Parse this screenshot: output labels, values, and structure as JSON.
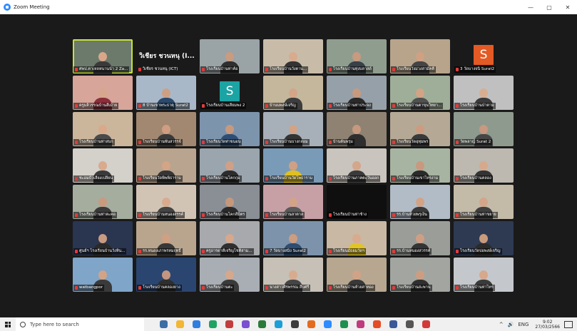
{
  "window": {
    "title": "Zoom Meeting",
    "controls": [
      "—",
      "▢",
      "✕"
    ]
  },
  "participants": [
    {
      "name": "ศพป.ตาเหลหนานน้า 2 Za...",
      "bg": "#6b7a6b",
      "skin": "#d9a68a",
      "shirt": "#3a3a3a",
      "active": true
    },
    {
      "name": "วิเชียร ชวนหนุ (ICT)",
      "bg": "#1a1a1a",
      "type": "nameonly",
      "big": "วิเชียร ชวนหนุ (I..."
    },
    {
      "name": "โรงเรียนบ้านท่าค้อ",
      "bg": "#9aa3a6",
      "skin": "#c99b7f",
      "shirt": "#2e2e2e"
    },
    {
      "name": "โรงเรียนบ้านวังตาน...",
      "bg": "#c8bca8",
      "skin": "#d8ab8e",
      "shirt": "#333333"
    },
    {
      "name": "โรงเรียนบ้านทุ่งบลาสด์",
      "bg": "#8f9d8f",
      "skin": "#c89a80",
      "shirt": "#384048"
    },
    {
      "name": "โรงเรียนวังม่วงสามัคคี",
      "bg": "#b7a48b",
      "skin": "#d0a083",
      "shirt": "#444444"
    },
    {
      "name": "3 วัดบางจนิ Surat2",
      "type": "avatar",
      "bg": "#1a1a1a",
      "avatarColor": "#e35a25",
      "letter": "S"
    },
    {
      "name": "ครูมลิวรรณบ้านสีเม้าย",
      "bg": "#d7a59a",
      "skin": "#d6a78c",
      "shirt": "#8b2d3a"
    },
    {
      "name": "8 บ้านเขาพระธาตุ Surat2",
      "bg": "#a9b8c8",
      "skin": "#cda084",
      "shirt": "#2b4a6b"
    },
    {
      "name": "โรงเรียนบ้านเสียมพง 2",
      "type": "avatar",
      "bg": "#1a1a1a",
      "avatarColor": "#1ca3a3",
      "letter": "S"
    },
    {
      "name": "บ้านนพงษ์เจริญ",
      "bg": "#c5b79c",
      "skin": "#d4a588",
      "shirt": "#3d3d3d"
    },
    {
      "name": "โรงเรียนบ้านท่าประจง",
      "bg": "#96a0a8",
      "skin": "#c79a7e",
      "shirt": "#2a2a2a"
    },
    {
      "name": "โรงเรียนบ้านตาขุนวิทยา...",
      "bg": "#9fae98",
      "skin": "#d2a385",
      "shirt": "#505050"
    },
    {
      "name": "โรงเรียนบ้านป่าตาม",
      "bg": "#c0c0c0",
      "skin": "#d8ae93",
      "shirt": "#3a3a3a"
    },
    {
      "name": "โรงเรียนบ้านท่าสบก",
      "bg": "#cbb69c",
      "skin": "#d9a98a",
      "shirt": "#4a4a4a"
    },
    {
      "name": "โรงเรียนบ้านพันสวรรจ์",
      "bg": "#a28870",
      "skin": "#cf9e82",
      "shirt": "#3a3a3a"
    },
    {
      "name": "โรงเรียนวัดท่าขนอน",
      "bg": "#7d94ad",
      "skin": "#c79a7e",
      "shirt": "#2f4e73"
    },
    {
      "name": "โรงเรียนบ้านบางกล่อม",
      "bg": "#a7b0b8",
      "skin": "#d2a386",
      "shirt": "#343434"
    },
    {
      "name": "บ้านต้นพรุม",
      "bg": "#8f8273",
      "skin": "#c6997e",
      "shirt": "#2e2e2e"
    },
    {
      "name": "โรงเรียนวัดอุทุมพร",
      "bg": "#b5a995",
      "skin": "#cd9c80",
      "shirt": "#3a3a3a"
    },
    {
      "name": "วัดพลาญ์ Surat 2",
      "bg": "#8e9a8e",
      "skin": "#c89880",
      "shirt": "#464646"
    },
    {
      "name": "ชะอมบัวเลียงเปลี่ยน",
      "bg": "#d4d0ca",
      "skin": "#d8aa8e",
      "shirt": "#3a3a3a"
    },
    {
      "name": "โรงเรียนวัดพิพพิธาราม",
      "bg": "#b9a48f",
      "skin": "#d4a487",
      "shirt": "#353535"
    },
    {
      "name": "โรงเรียนบ้านโคกกุม",
      "bg": "#9ba5ae",
      "skin": "#cfa086",
      "shirt": "#2c2c2c"
    },
    {
      "name": "โรงเรียนบ้านวัดโพธาราม",
      "bg": "#7a9bb8",
      "skin": "#d0a085",
      "shirt": "#e0c020"
    },
    {
      "name": "โรงเรียนบ้านภาคตะวันออก",
      "bg": "#c9c4bd",
      "skin": "#d4a68a",
      "shirt": "#3a3a3a"
    },
    {
      "name": "โรงเรียนบ้านเขาไทรงาม",
      "bg": "#a8b4a2",
      "skin": "#c8997e",
      "shirt": "#2a2a2a"
    },
    {
      "name": "โรงเรียนบ้านคลอง",
      "bg": "#bdb8b0",
      "skin": "#d6a98c",
      "shirt": "#333333"
    },
    {
      "name": "โรงเรียนบ้านท่าตะคอ",
      "bg": "#a5ad9f",
      "skin": "#c99a7f",
      "shirt": "#3a3a3a"
    },
    {
      "name": "โรงเรียนบ้านหนองสรรค์",
      "bg": "#d2c4b4",
      "skin": "#d8ab8f",
      "shirt": "#444444"
    },
    {
      "name": "โรงเรียนบ้านโคกสีมิตร",
      "bg": "#8a8f95",
      "skin": "#c5987c",
      "shirt": "#2b2b2b"
    },
    {
      "name": "โรงเรียนบ้านลาตาล",
      "bg": "#c7a0a6",
      "skin": "#d3a388",
      "shirt": "#5a5a5a"
    },
    {
      "name": "โรงเรียนบ้านท่าช้าง",
      "bg": "#0f0f0f",
      "skin": "#0f0f0f",
      "shirt": "#0f0f0f",
      "dark": true
    },
    {
      "name": "รร.บ้านห้วยพรุเงิน",
      "bg": "#b2bcc6",
      "skin": "#d2a387",
      "shirt": "#3a3a3a"
    },
    {
      "name": "โรงเรียนบ้านท่าขยาย",
      "bg": "#c4baa8",
      "skin": "#d4a58a",
      "shirt": "#3f3f3f"
    },
    {
      "name": "ศูนย์ฯ โรงเรียนบ้านวังหิน...",
      "bg": "#2a3550",
      "skin": "#c99b80",
      "shirt": "#2a2a2a"
    },
    {
      "name": "รร.หนองเภาพรหมฤทธิ์",
      "bg": "#b9a58d",
      "skin": "#d0a085",
      "shirt": "#383838"
    },
    {
      "name": "ครูอารดาดีเจริญโชติสาม...",
      "bg": "#a7a9ad",
      "skin": "#d6a88c",
      "shirt": "#2f2f2f"
    },
    {
      "name": "7 วัดบางสมิง Surat2",
      "bg": "#7c93ab",
      "skin": "#cc9d81",
      "shirt": "#2e4d70"
    },
    {
      "name": "โรงเรียนมัธยมวัดฯ",
      "bg": "#c8b8a4",
      "skin": "#d8ab8f",
      "shirt": "#e0c428"
    },
    {
      "name": "รร.บ้านหนองสวรรค์",
      "bg": "#9a9d98",
      "skin": "#cf9f84",
      "shirt": "#343434"
    },
    {
      "name": "โรงเรียนวัดบ่อพงษ์เจริญ",
      "bg": "#2e3a52",
      "skin": "#c89a7e",
      "shirt": "#2b2b2b"
    },
    {
      "name": "watbangpor",
      "bg": "#7fa5c8",
      "skin": "#d2a387",
      "shirt": "#3a3a3a"
    },
    {
      "name": "โรงเรียนบ้านคลองยาง",
      "bg": "#2a4670",
      "skin": "#c49680",
      "shirt": "#2e2e2e"
    },
    {
      "name": "โรงเรียนบ้านตะ",
      "bg": "#a8aeb4",
      "skin": "#d5a78b",
      "shirt": "#3a3a3a"
    },
    {
      "name": "นางสาวศิรพรรณ สืบศรี",
      "bg": "#c6c0b6",
      "skin": "#d8ab8f",
      "shirt": "#454545"
    },
    {
      "name": "โรงเรียนบ้านห้วยสาทอง",
      "bg": "#b7a791",
      "skin": "#d2a286",
      "shirt": "#383838"
    },
    {
      "name": "โรงเรียนบ้านสะพาน",
      "bg": "#a3a6a0",
      "skin": "#cd9d82",
      "shirt": "#2f2f2f"
    },
    {
      "name": "โรงเรียนบ้านท่าไทร",
      "bg": "#c4c8cc",
      "skin": "#d6a88c",
      "shirt": "#3a3a3a"
    }
  ],
  "taskbar": {
    "search_placeholder": "Type here to search",
    "apps": [
      "#3a6ea5",
      "#f2b632",
      "#2f7de0",
      "#1ea362",
      "#c43d3d",
      "#7a4fd0",
      "#2b7a3a",
      "#1aa0d8",
      "#3d3d3d",
      "#e46b1e",
      "#2d8cff",
      "#1f8f4e",
      "#c03b7e",
      "#e44d26",
      "#3b5998",
      "#555555",
      "#d23a3a"
    ],
    "tray_symbols": [
      "^",
      "🔊",
      "ENG"
    ],
    "time": "9:02",
    "date": "27/03/2566"
  }
}
